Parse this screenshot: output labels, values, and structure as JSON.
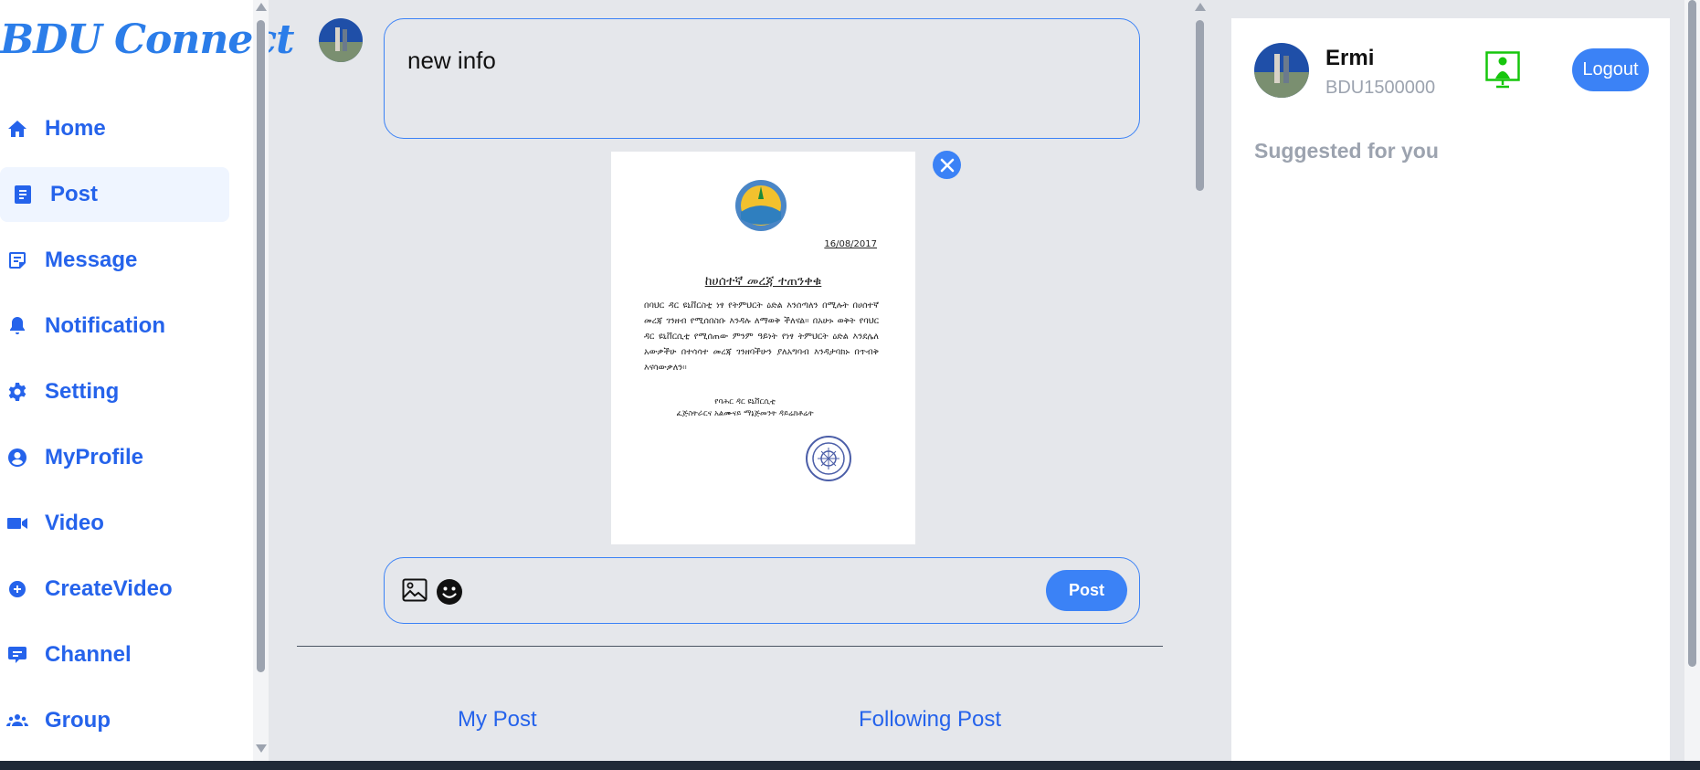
{
  "sidebar": {
    "brand": "BDU Connect",
    "items": [
      {
        "label": "Home",
        "icon": "home-icon"
      },
      {
        "label": "Post",
        "icon": "post-icon",
        "active": true
      },
      {
        "label": "Message",
        "icon": "message-icon"
      },
      {
        "label": "Notification",
        "icon": "bell-icon"
      },
      {
        "label": "Setting",
        "icon": "gear-icon"
      },
      {
        "label": "MyProfile",
        "icon": "user-icon"
      },
      {
        "label": "Video",
        "icon": "video-icon"
      },
      {
        "label": "CreateVideo",
        "icon": "plus-circle-icon"
      },
      {
        "label": "Channel",
        "icon": "channel-icon"
      },
      {
        "label": "Group",
        "icon": "group-icon"
      }
    ]
  },
  "composer": {
    "text": "new info",
    "attachment": {
      "date": "16/08/2017",
      "title": "ከሀሰተኛ መረጃ ተጠንቀቁ",
      "body": "በባህር ዳር ዩኒቨርስቲ ነፃ የትምህርት ዕድል እንሰጣለን በሚሉት በሀሰተኛ መረጃ ገንዘብ የሚሰበስቡ እንዳሉ ለማወቅ ችለናል። በአሁኑ ወቅት የባህር ዳር ዩኒቨርሲቲ የሚሰጠው ምንም ዓይነት የነፃ ትምህርት ዕድል እንደሌለ አውቃችሁ በተሳሳተ መረጃ ገንዘባችሁን ያለአግባብ እንዳታባክኑ በጥብቅ እናሳውቃለን።",
      "signature_line1": "የባሕር ዳር ዩኒቨርሲቲ",
      "signature_line2": "ፈጅስትራርና አልሙናይ ማኔጅመንት ዳይሬክቶሬት"
    },
    "post_label": "Post"
  },
  "feed_tabs": [
    "My Post",
    "Following Post"
  ],
  "user": {
    "name": "Ermi",
    "id": "BDU1500000",
    "logout_label": "Logout"
  },
  "suggested_heading": "Suggested for you",
  "colors": {
    "accent": "#3b82f6",
    "link": "#2563eb",
    "background": "#e5e7eb",
    "presence": "#16c60c"
  }
}
